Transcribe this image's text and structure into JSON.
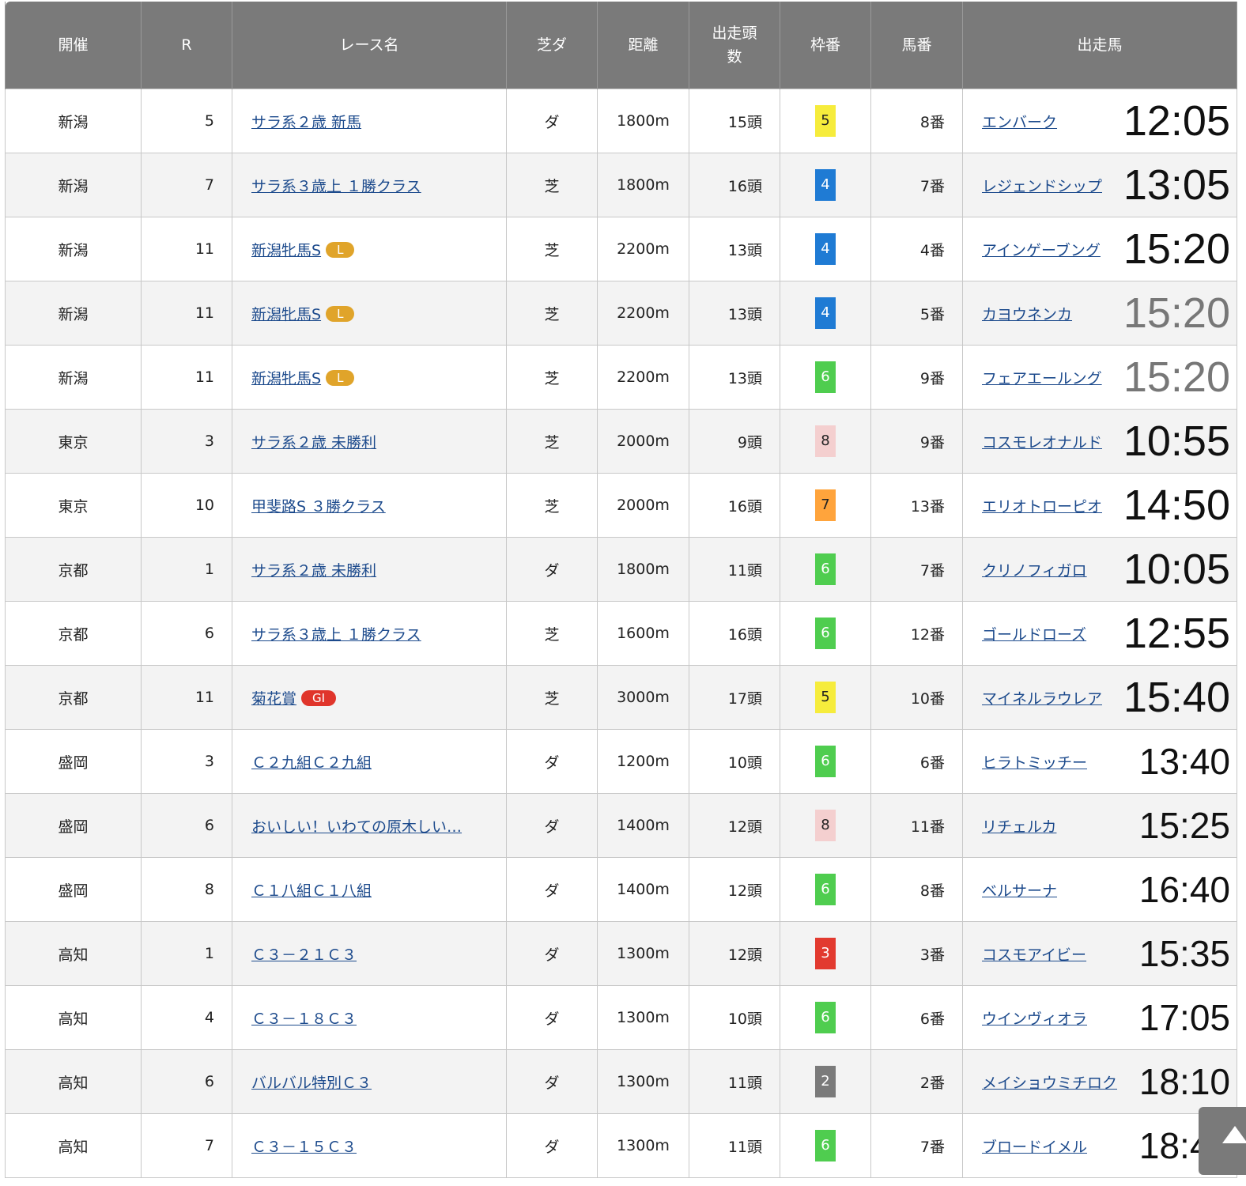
{
  "headers": [
    "開催",
    "R",
    "レース名",
    "芝ダ",
    "距離",
    "出走頭数",
    "枠番",
    "馬番",
    "出走馬"
  ],
  "waku_colors": {
    "2": "#7a7a7a",
    "3": "#e23a2f",
    "4": "#1f7bd4",
    "5": "#f6ec3c",
    "6": "#4fcd4f",
    "7": "#ffa43c",
    "8": "#f4cfcf"
  },
  "grade_colors": {
    "L": "#e0a42a",
    "GI": "#e0352b"
  },
  "rows": [
    {
      "venue": "新潟",
      "r": "5",
      "race": "サラ系２歳 新馬",
      "grade": "",
      "surface": "ダ",
      "distance": "1800m",
      "runners": "15頭",
      "waku": "5",
      "umaban": "8番",
      "horse": "エンバーク",
      "time": "12:05",
      "time_dim": false
    },
    {
      "venue": "新潟",
      "r": "7",
      "race": "サラ系３歳上 １勝クラス",
      "grade": "",
      "surface": "芝",
      "distance": "1800m",
      "runners": "16頭",
      "waku": "4",
      "umaban": "7番",
      "horse": "レジェンドシップ",
      "time": "13:05",
      "time_dim": false
    },
    {
      "venue": "新潟",
      "r": "11",
      "race": "新潟牝馬S",
      "grade": "L",
      "surface": "芝",
      "distance": "2200m",
      "runners": "13頭",
      "waku": "4",
      "umaban": "4番",
      "horse": "アインゲーブング",
      "time": "15:20",
      "time_dim": false
    },
    {
      "venue": "新潟",
      "r": "11",
      "race": "新潟牝馬S",
      "grade": "L",
      "surface": "芝",
      "distance": "2200m",
      "runners": "13頭",
      "waku": "4",
      "umaban": "5番",
      "horse": "カヨウネンカ",
      "time": "15:20",
      "time_dim": true
    },
    {
      "venue": "新潟",
      "r": "11",
      "race": "新潟牝馬S",
      "grade": "L",
      "surface": "芝",
      "distance": "2200m",
      "runners": "13頭",
      "waku": "6",
      "umaban": "9番",
      "horse": "フェアエールング",
      "time": "15:20",
      "time_dim": true
    },
    {
      "venue": "東京",
      "r": "3",
      "race": "サラ系２歳 未勝利",
      "grade": "",
      "surface": "芝",
      "distance": "2000m",
      "runners": "9頭",
      "waku": "8",
      "umaban": "9番",
      "horse": "コスモレオナルド",
      "time": "10:55",
      "time_dim": false
    },
    {
      "venue": "東京",
      "r": "10",
      "race": "甲斐路S ３勝クラス",
      "grade": "",
      "surface": "芝",
      "distance": "2000m",
      "runners": "16頭",
      "waku": "7",
      "umaban": "13番",
      "horse": "エリオトローピオ",
      "time": "14:50",
      "time_dim": false
    },
    {
      "venue": "京都",
      "r": "1",
      "race": "サラ系２歳 未勝利",
      "grade": "",
      "surface": "ダ",
      "distance": "1800m",
      "runners": "11頭",
      "waku": "6",
      "umaban": "7番",
      "horse": "クリノフィガロ",
      "time": "10:05",
      "time_dim": false
    },
    {
      "venue": "京都",
      "r": "6",
      "race": "サラ系３歳上 １勝クラス",
      "grade": "",
      "surface": "芝",
      "distance": "1600m",
      "runners": "16頭",
      "waku": "6",
      "umaban": "12番",
      "horse": "ゴールドローズ",
      "time": "12:55",
      "time_dim": false
    },
    {
      "venue": "京都",
      "r": "11",
      "race": "菊花賞",
      "grade": "GI",
      "surface": "芝",
      "distance": "3000m",
      "runners": "17頭",
      "waku": "5",
      "umaban": "10番",
      "horse": "マイネルラウレア",
      "time": "15:40",
      "time_dim": false
    },
    {
      "venue": "盛岡",
      "r": "3",
      "race": "Ｃ２九組Ｃ２九組",
      "grade": "",
      "surface": "ダ",
      "distance": "1200m",
      "runners": "10頭",
      "waku": "6",
      "umaban": "6番",
      "horse": "ヒラトミッチー",
      "time": "13:40",
      "time_dim": false
    },
    {
      "venue": "盛岡",
      "r": "6",
      "race": "おいしい！いわての原木しい…",
      "grade": "",
      "surface": "ダ",
      "distance": "1400m",
      "runners": "12頭",
      "waku": "8",
      "umaban": "11番",
      "horse": "リチェルカ",
      "time": "15:25",
      "time_dim": false
    },
    {
      "venue": "盛岡",
      "r": "8",
      "race": "Ｃ１八組Ｃ１八組",
      "grade": "",
      "surface": "ダ",
      "distance": "1400m",
      "runners": "12頭",
      "waku": "6",
      "umaban": "8番",
      "horse": "ベルサーナ",
      "time": "16:40",
      "time_dim": false
    },
    {
      "venue": "高知",
      "r": "1",
      "race": "Ｃ３－２１Ｃ３",
      "grade": "",
      "surface": "ダ",
      "distance": "1300m",
      "runners": "12頭",
      "waku": "3",
      "umaban": "3番",
      "horse": "コスモアイビー",
      "time": "15:35",
      "time_dim": false
    },
    {
      "venue": "高知",
      "r": "4",
      "race": "Ｃ３－１８Ｃ３",
      "grade": "",
      "surface": "ダ",
      "distance": "1300m",
      "runners": "10頭",
      "waku": "6",
      "umaban": "6番",
      "horse": "ウインヴィオラ",
      "time": "17:05",
      "time_dim": false
    },
    {
      "venue": "高知",
      "r": "6",
      "race": "バルバル特別Ｃ３",
      "grade": "",
      "surface": "ダ",
      "distance": "1300m",
      "runners": "11頭",
      "waku": "2",
      "umaban": "2番",
      "horse": "メイショウミチロク",
      "time": "18:10",
      "time_dim": false
    },
    {
      "venue": "高知",
      "r": "7",
      "race": "Ｃ３－１５Ｃ３",
      "grade": "",
      "surface": "ダ",
      "distance": "1300m",
      "runners": "11頭",
      "waku": "6",
      "umaban": "7番",
      "horse": "ブロードイメル",
      "time": "18:40",
      "time_dim": false
    }
  ]
}
